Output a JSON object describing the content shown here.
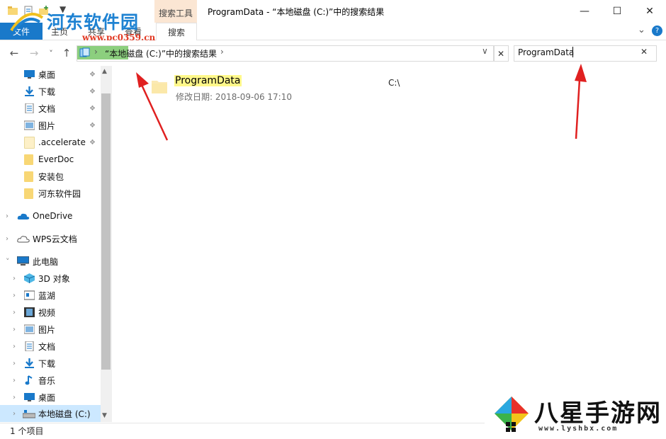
{
  "window": {
    "title": "ProgramData - “本地磁盘 (C:)”中的搜索结果",
    "minimize": "—",
    "maximize": "☐",
    "close": "✕",
    "context_tab": "搜索工具"
  },
  "ribbon": {
    "file_tab": "文件",
    "tabs": [
      "主页",
      "共享",
      "查看",
      "搜索"
    ],
    "expand": "⌄",
    "help": "?"
  },
  "nav": {
    "back": "←",
    "forward": "→",
    "recent": "˅",
    "up": "↑",
    "address": "“本地磁盘 (C:)”中的搜索结果",
    "sep": "›",
    "dropdown": "∨",
    "address_clear": "✕"
  },
  "search": {
    "value": "ProgramData",
    "clear": "✕"
  },
  "sidebar": {
    "quick_access": [
      {
        "label": "桌面",
        "icon": "desktop-icon",
        "pinned": true
      },
      {
        "label": "下载",
        "icon": "download-icon",
        "pinned": true
      },
      {
        "label": "文档",
        "icon": "document-icon",
        "pinned": true
      },
      {
        "label": "图片",
        "icon": "picture-icon",
        "pinned": true
      },
      {
        "label": ".accelerate",
        "icon": "folder-icon",
        "pinned": true
      },
      {
        "label": "EverDoc",
        "icon": "folder-icon",
        "pinned": false
      },
      {
        "label": "安装包",
        "icon": "folder-icon",
        "pinned": false
      },
      {
        "label": "河东软件园",
        "icon": "folder-icon",
        "pinned": false
      }
    ],
    "onedrive": "OneDrive",
    "wps": "WPS云文档",
    "this_pc": "此电脑",
    "pc_items": [
      {
        "label": "3D 对象",
        "icon": "3d-objects-icon"
      },
      {
        "label": "蓝湖",
        "icon": "lanhu-icon"
      },
      {
        "label": "视频",
        "icon": "video-icon"
      },
      {
        "label": "图片",
        "icon": "picture-icon"
      },
      {
        "label": "文档",
        "icon": "document-icon"
      },
      {
        "label": "下载",
        "icon": "download-icon"
      },
      {
        "label": "音乐",
        "icon": "music-icon"
      },
      {
        "label": "桌面",
        "icon": "desktop-icon"
      },
      {
        "label": "本地磁盘 (C:)",
        "icon": "drive-icon"
      }
    ],
    "pin_glyph": "📌",
    "chevron_right": "›",
    "chevron_down": "˅"
  },
  "result": {
    "name": "ProgramData",
    "meta": "修改日期: 2018-09-06 17:10",
    "path": "C:\\"
  },
  "status": {
    "text": "1 个项目"
  },
  "watermark": {
    "site_title": "河东软件园",
    "site_url": "www.pc0359.cn",
    "brand2_title": "八星手游网",
    "brand2_url": "www.lyshbx.com"
  },
  "colors": {
    "accent": "#1979ca",
    "highlight": "#fff88a",
    "selection": "#cce8ff",
    "arrow": "#e02020",
    "breadcrumb_green": "#8ccf7e"
  }
}
